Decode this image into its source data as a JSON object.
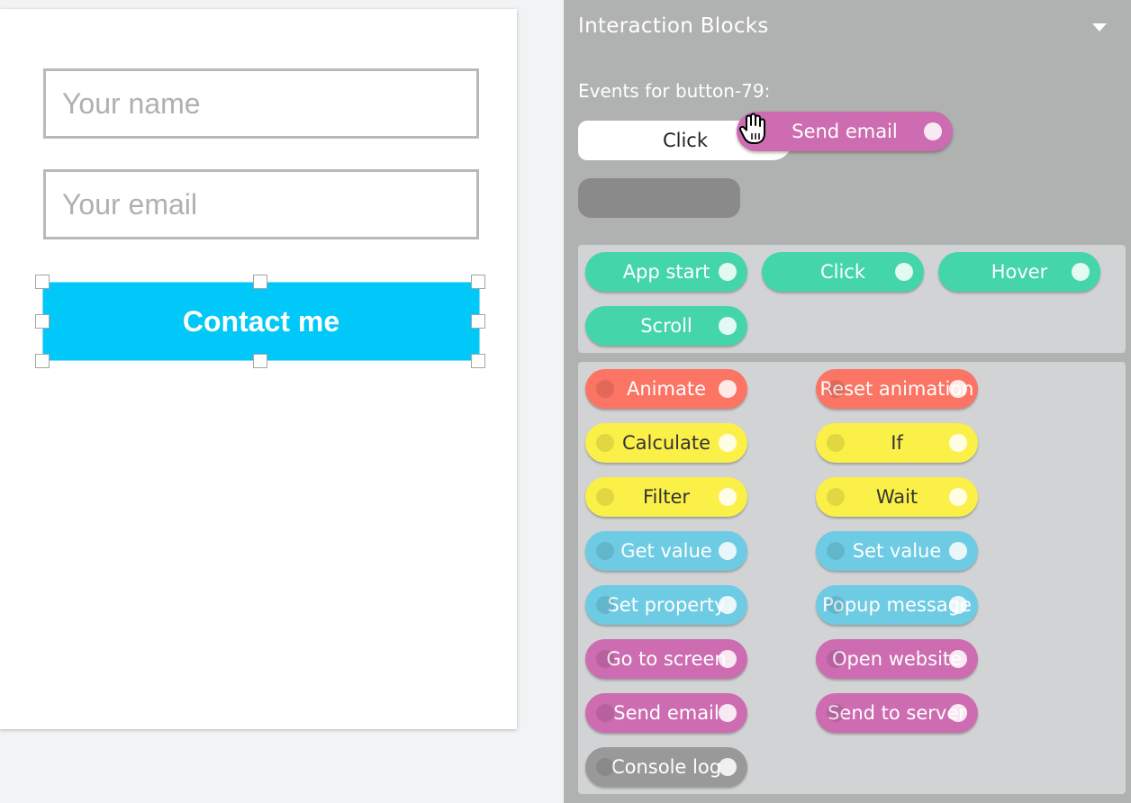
{
  "canvas": {
    "name_placeholder": "Your name",
    "email_placeholder": "Your email",
    "contact_button_label": "Contact me",
    "contact_button_color": "#00c8f8"
  },
  "panel": {
    "title": "Interaction Blocks",
    "events_prefix": "Events for ",
    "events_target": "button-79",
    "events_suffix": ":",
    "current_event": "Click",
    "dragging_block": {
      "label": "Send email",
      "color": "#cd6cb1"
    }
  },
  "colors": {
    "trigger": "#45d5ab",
    "animate": "#fc7464",
    "logic": "#fbf048",
    "data": "#6ecbe4",
    "navigation": "#cd6cb1",
    "console": "#999999"
  },
  "triggers": [
    {
      "label": "App start"
    },
    {
      "label": "Click"
    },
    {
      "label": "Hover"
    },
    {
      "label": "Scroll"
    }
  ],
  "actions": [
    {
      "label": "Animate",
      "category": "animate"
    },
    {
      "label": "Reset animation",
      "category": "animate"
    },
    {
      "label": "Calculate",
      "category": "logic"
    },
    {
      "label": "If",
      "category": "logic"
    },
    {
      "label": "Filter",
      "category": "logic"
    },
    {
      "label": "Wait",
      "category": "logic"
    },
    {
      "label": "Get value",
      "category": "data"
    },
    {
      "label": "Set value",
      "category": "data"
    },
    {
      "label": "Set property",
      "category": "data"
    },
    {
      "label": "Popup message",
      "category": "data"
    },
    {
      "label": "Go to screen",
      "category": "navigation"
    },
    {
      "label": "Open website",
      "category": "navigation"
    },
    {
      "label": "Send email",
      "category": "navigation"
    },
    {
      "label": "Send to server",
      "category": "navigation"
    },
    {
      "label": "Console log",
      "category": "console"
    }
  ]
}
